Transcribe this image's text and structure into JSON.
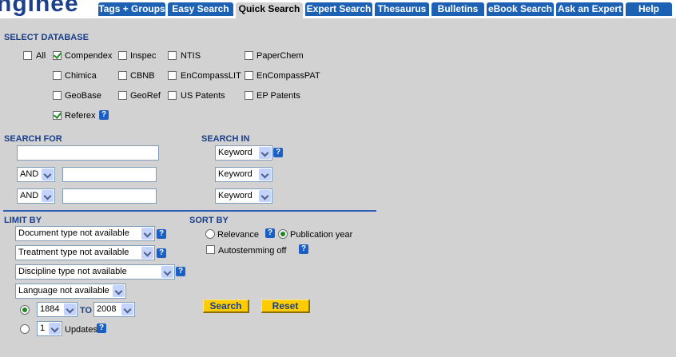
{
  "logo_fragment": "nginee",
  "tabs": [
    {
      "label": "Tags + Groups"
    },
    {
      "label": "Easy Search"
    },
    {
      "label": "Quick Search",
      "active": true
    },
    {
      "label": "Expert Search"
    },
    {
      "label": "Thesaurus"
    },
    {
      "label": "Bulletins"
    },
    {
      "label": "eBook Search"
    },
    {
      "label": "Ask an Expert"
    },
    {
      "label": "Help"
    }
  ],
  "select_database": {
    "header": "SELECT DATABASE",
    "databases": [
      {
        "label": "All",
        "checked": false
      },
      {
        "label": "Compendex",
        "checked": true
      },
      {
        "label": "Inspec",
        "checked": false
      },
      {
        "label": "NTIS",
        "checked": false
      },
      {
        "label": "PaperChem",
        "checked": false
      },
      {
        "label": "Chimica",
        "checked": false
      },
      {
        "label": "CBNB",
        "checked": false
      },
      {
        "label": "EnCompassLIT",
        "checked": false
      },
      {
        "label": "EnCompassPAT",
        "checked": false
      },
      {
        "label": "GeoBase",
        "checked": false
      },
      {
        "label": "GeoRef",
        "checked": false
      },
      {
        "label": "US Patents",
        "checked": false
      },
      {
        "label": "EP Patents",
        "checked": false
      },
      {
        "label": "Referex",
        "checked": true
      }
    ]
  },
  "search_for": {
    "header": "SEARCH FOR",
    "term1": "",
    "connector2": "AND",
    "term2": "",
    "connector3": "AND",
    "term3": ""
  },
  "search_in": {
    "header": "SEARCH IN",
    "field1": "Keyword",
    "field2": "Keyword",
    "field3": "Keyword"
  },
  "limit_by": {
    "header": "LIMIT BY",
    "document_type": "Document type not available",
    "treatment_type": "Treatment type not available",
    "discipline_type": "Discipline type not available",
    "language": "Language not available",
    "from_year": "1884",
    "to_label": "TO",
    "to_year": "2008",
    "updates_count": "1",
    "updates_label": "Updates",
    "year_range_selected": true,
    "updates_selected": false
  },
  "sort_by": {
    "header": "SORT BY",
    "relevance_label": "Relevance",
    "relevance_selected": false,
    "pubyear_label": "Publication year",
    "pubyear_selected": true,
    "autostemming_label": "Autostemming off",
    "autostemming_checked": false
  },
  "buttons": {
    "search": "Search",
    "reset": "Reset"
  },
  "help_glyph": "?",
  "colors": {
    "tab_blue": "#1c61b4",
    "panel_gray": "#d2d2d2",
    "header_navy": "#1a3f8a",
    "button_yellow": "#ffcc00",
    "check_green": "#1a8a1a"
  }
}
